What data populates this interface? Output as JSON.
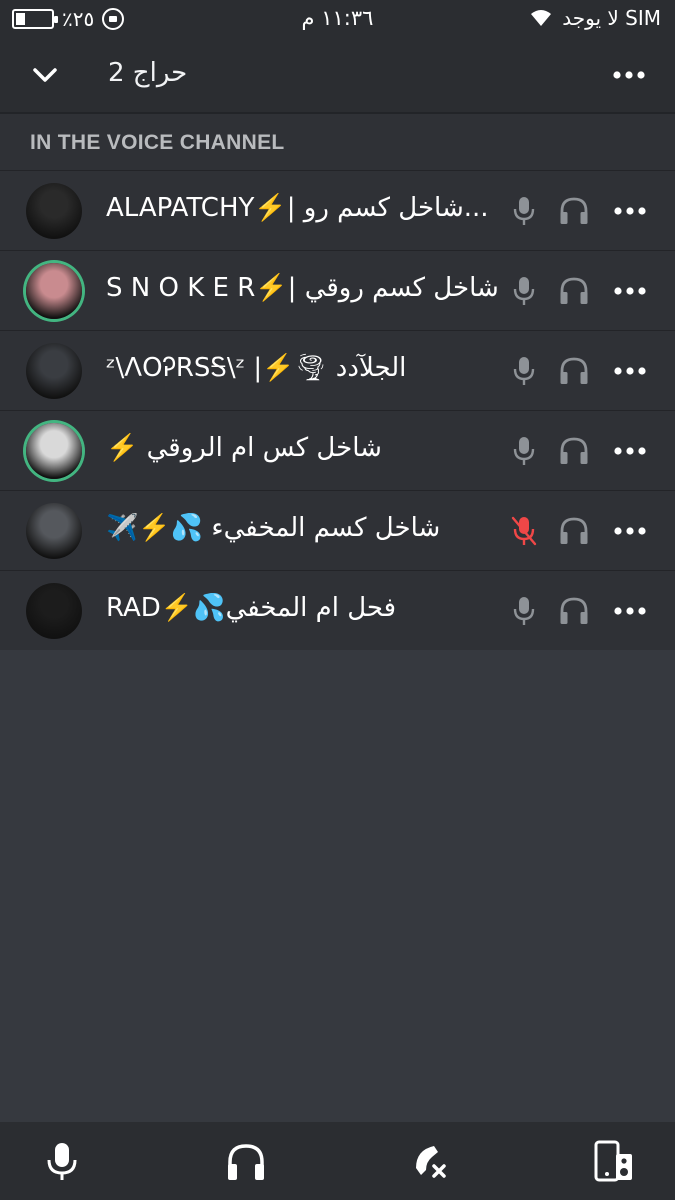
{
  "status_bar": {
    "battery_text": "٪٢٥",
    "battery_level": 0.25,
    "time": "١١:٣٦ م",
    "carrier": "لا يوجد SIM"
  },
  "header": {
    "channel_name": "حراج 2"
  },
  "section": {
    "label": "IN THE VOICE CHANNEL"
  },
  "members": [
    {
      "name": "ALAPATCHY⚡️| شاخل كسم رو...",
      "speaking": false,
      "mic_muted": false
    },
    {
      "name": "S N O K E R⚡️| شاخل كسم روقي",
      "speaking": true,
      "mic_muted": false
    },
    {
      "name": "ᶻ\\ΛOᎮRSᎦ\\ᶻ |⚡️🌪 الجلآدد",
      "speaking": false,
      "mic_muted": false
    },
    {
      "name": "⚡️ شاخل كس ام الروقي",
      "speaking": true,
      "mic_muted": false
    },
    {
      "name": "✈️⚡️💦 شاخل كسم المخفيء",
      "speaking": false,
      "mic_muted": true
    },
    {
      "name": "RAD⚡️💦فحل ام المخفي",
      "speaking": false,
      "mic_muted": false
    }
  ],
  "colors": {
    "background": "#36393f",
    "rows": "#2f3136",
    "bars": "#2b2d31",
    "speaking_ring": "#43b581",
    "icon_gray": "#8e9297",
    "muted_red": "#f04747"
  },
  "controls": [
    "microphone-icon",
    "headphones-icon",
    "hang-up-icon",
    "speaker-output-icon"
  ]
}
